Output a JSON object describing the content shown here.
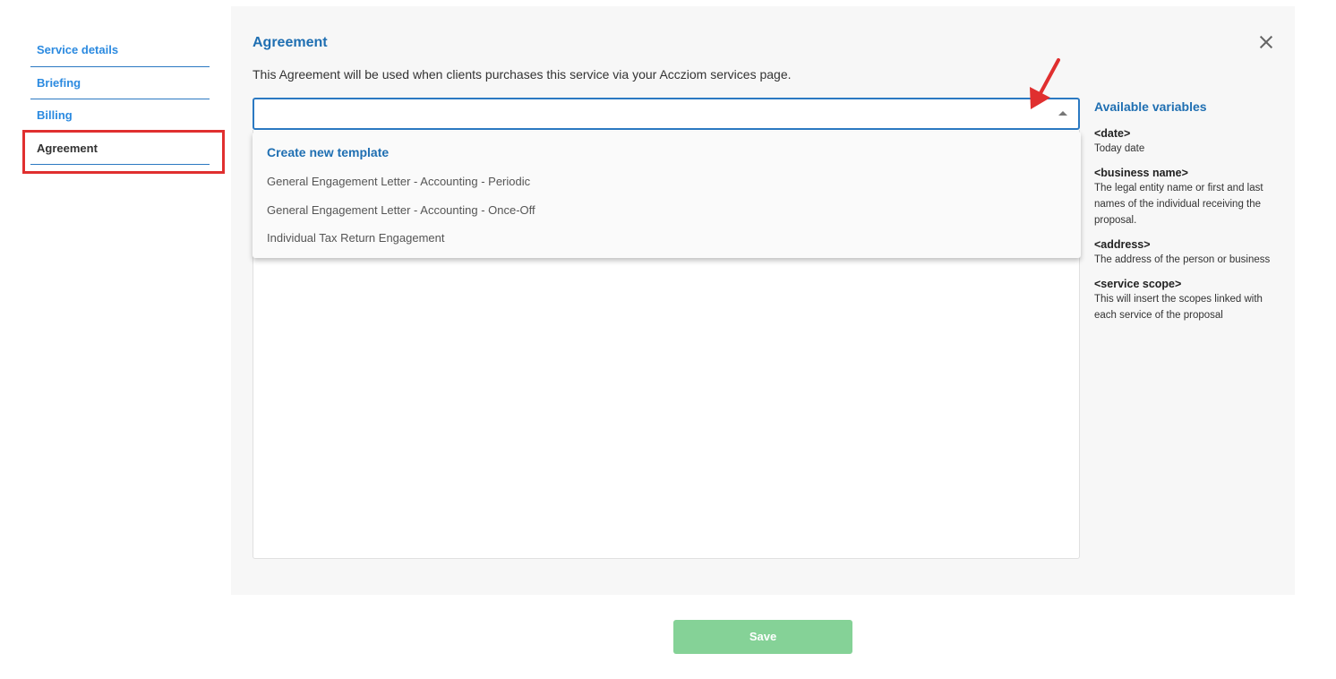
{
  "sidebar": {
    "items": [
      {
        "label": "Service details"
      },
      {
        "label": "Briefing"
      },
      {
        "label": "Billing"
      },
      {
        "label": "Agreement"
      }
    ]
  },
  "panel": {
    "title": "Agreement",
    "description": "This Agreement will be used when clients purchases this service via your Accziom services page.",
    "select": {
      "value": ""
    },
    "dropdown": {
      "create_label": "Create new template",
      "options": [
        "General Engagement Letter - Accounting - Periodic",
        "General Engagement Letter - Accounting - Once-Off",
        "Individual Tax Return Engagement"
      ]
    },
    "variables": {
      "title": "Available variables",
      "items": [
        {
          "name": "<date>",
          "desc": "Today date"
        },
        {
          "name": "<business name>",
          "desc": "The legal entity name or first and last names of the individual receiving the proposal."
        },
        {
          "name": "<address>",
          "desc": "The address of the person or business"
        },
        {
          "name": "<service scope>",
          "desc": "This will insert the scopes linked with each service of the proposal"
        }
      ]
    }
  },
  "footer": {
    "save_label": "Save"
  },
  "colors": {
    "accent": "#1f6fb2",
    "link": "#2b8ae0",
    "save": "#85d297",
    "highlight": "#e02f2f"
  },
  "icons": {
    "close": "close-icon",
    "caret": "caret-up-icon",
    "annotation": "red-arrow-icon"
  }
}
